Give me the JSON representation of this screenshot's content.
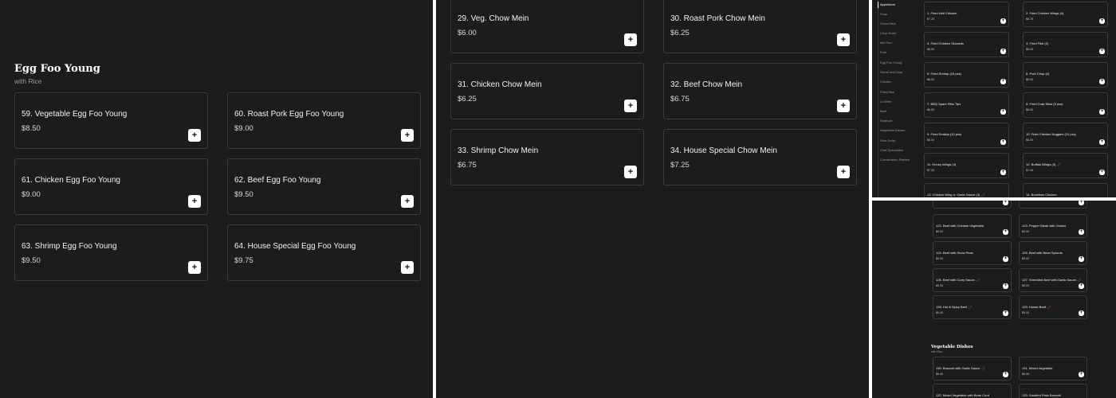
{
  "egg_foo_young": {
    "title": "Egg Foo Young",
    "subtitle": "with Rice",
    "items": [
      {
        "name": "59. Vegetable Egg Foo Young",
        "price": "$8.50"
      },
      {
        "name": "60. Roast Pork Egg Foo Young",
        "price": "$9.00"
      },
      {
        "name": "61. Chicken Egg Foo Young",
        "price": "$9.00"
      },
      {
        "name": "62. Beef Egg Foo Young",
        "price": "$9.50"
      },
      {
        "name": "63. Shrimp Egg Foo Young",
        "price": "$9.50"
      },
      {
        "name": "64. House Special Egg Foo Young",
        "price": "$9.75"
      }
    ]
  },
  "chow_mein": {
    "items": [
      {
        "name": "29. Veg. Chow Mein",
        "price": "$6.00"
      },
      {
        "name": "30. Roast Pork Chow Mein",
        "price": "$6.25"
      },
      {
        "name": "31. Chicken Chow Mein",
        "price": "$6.25"
      },
      {
        "name": "32. Beef Chow Mein",
        "price": "$6.75"
      },
      {
        "name": "33. Shrimp Chow Mein",
        "price": "$6.75"
      },
      {
        "name": "34. House Special Chow Mein",
        "price": "$7.25"
      }
    ]
  },
  "add_label": "+",
  "spicy_mark": "🌶",
  "categories": [
    "Appetizers",
    "Soup",
    "Chow Mein",
    "Chop Suey",
    "Mei Fun",
    "Pork",
    "Egg Foo Young",
    "Sweet and Sour",
    "Chicken",
    "Fried Rice",
    "Lo Mein",
    "Beef",
    "Seafood",
    "Vegetable Dishes",
    "Side Order",
    "Chef Specialties",
    "Combination Platters"
  ],
  "appetizers": {
    "items": [
      {
        "name": "1. Fried Half Chicken",
        "price": "$7.25"
      },
      {
        "name": "2. Fried Chicken Wings (4)",
        "price": "$6.75"
      },
      {
        "name": "3. Fried Chicken Gizzards",
        "price": "$6.00"
      },
      {
        "name": "4. Fried Fish (2)",
        "price": "$6.25"
      },
      {
        "name": "5. Fried Shrimp (15 pcs)",
        "price": "$6.00"
      },
      {
        "name": "6. Pork Chop (2)",
        "price": "$6.00"
      },
      {
        "name": "7. BBQ Spare Ribs Tips",
        "price": "$6.50"
      },
      {
        "name": "8. Fried Crab Stick (5 pcs)",
        "price": "$6.00"
      },
      {
        "name": "9. Fried Scallop (10 pcs)",
        "price": "$6.00"
      },
      {
        "name": "10. Fried Chicken Nuggets (10 pcs)",
        "price": "$6.00"
      },
      {
        "name": "11. Honey Wings (4)",
        "price": "$7.25"
      },
      {
        "name": "12. Buffalo Wings (4)",
        "price": "$7.25"
      },
      {
        "name": "13. Chicken Wing w. Garlic Sauce (4)",
        "price": ""
      },
      {
        "name": "14. Boneless Chicken",
        "price": ""
      }
    ]
  },
  "beef": {
    "items": [
      {
        "name": "122. Beef with Chinese Vegetable",
        "price": "$9.00"
      },
      {
        "name": "123. Pepper Steak with Onions",
        "price": "$9.00"
      },
      {
        "name": "124. Beef with Snow Peas",
        "price": "$9.00"
      },
      {
        "name": "125. Beef with Bean Sprouts",
        "price": "$9.00"
      },
      {
        "name": "126. Beef with Curry Sauce",
        "price": "$9.00"
      },
      {
        "name": "127. Shredded Beef with Garlic Sauce",
        "price": "$9.00"
      },
      {
        "name": "128. Hot & Spicy Beef",
        "price": "$9.00"
      },
      {
        "name": "129. Hunan Beef",
        "price": "$9.00"
      }
    ]
  },
  "vegetable_dishes": {
    "title": "Vegetable Dishes",
    "subtitle": "with Rice",
    "items": [
      {
        "name": "130. Broccoli with Garlic Sauce",
        "price": "$6.50"
      },
      {
        "name": "131. Mixed Vegetable",
        "price": "$6.50"
      },
      {
        "name": "132. Mixed Vegetable with Bean Curd",
        "price": ""
      },
      {
        "name": "133. Sautéed Plain Broccoli",
        "price": ""
      }
    ]
  }
}
